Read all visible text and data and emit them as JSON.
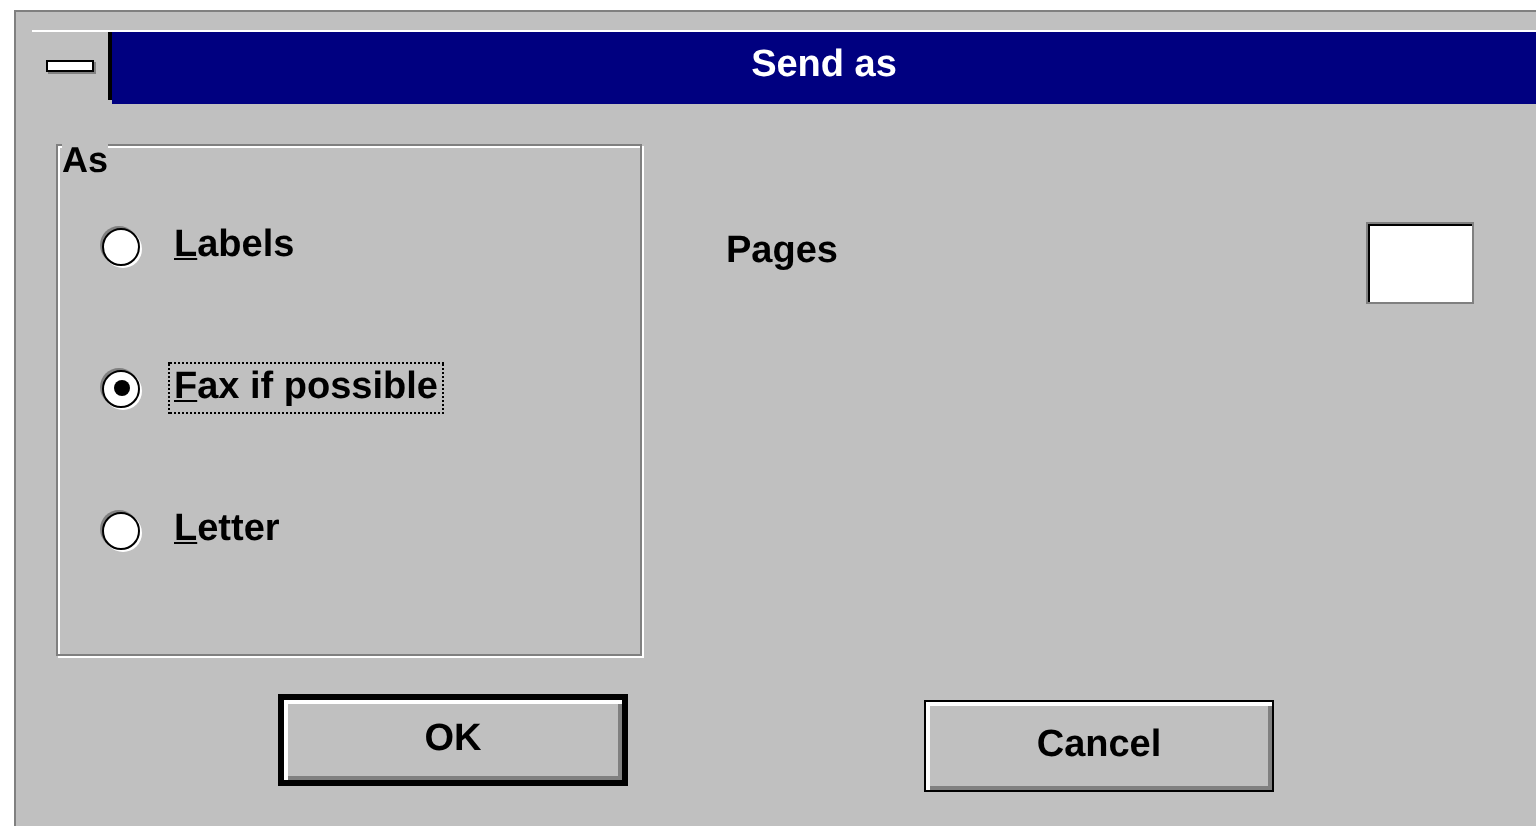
{
  "window": {
    "title": "Send as"
  },
  "group": {
    "label": "As",
    "options": [
      {
        "access_key": "L",
        "label_rest": "abels",
        "selected": false,
        "focused": false
      },
      {
        "access_key": "F",
        "label_rest": "ax if possible",
        "selected": true,
        "focused": true
      },
      {
        "access_key": "L",
        "label_rest": "etter",
        "selected": false,
        "focused": false
      }
    ]
  },
  "pages_field": {
    "label": "Pages"
  },
  "buttons": [
    {
      "label": "OK",
      "default": true
    },
    {
      "label": "Cancel",
      "default": false
    }
  ]
}
